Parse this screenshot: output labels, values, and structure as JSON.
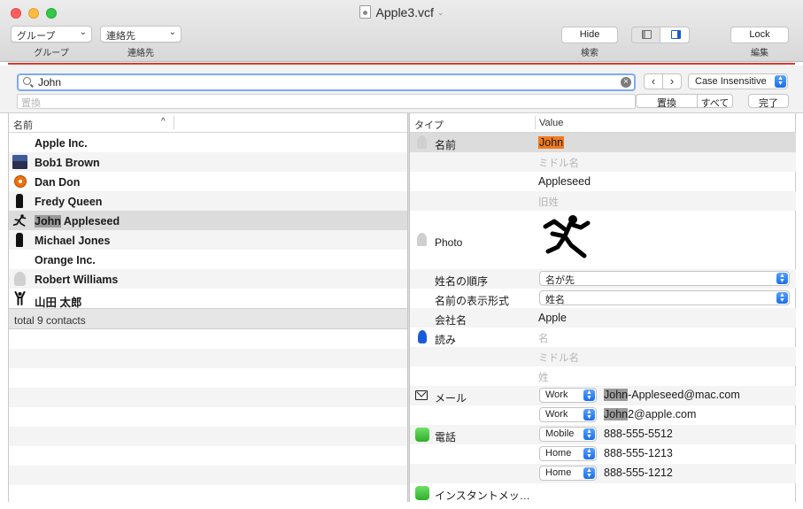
{
  "window": {
    "title": "Apple3.vcf"
  },
  "toolbar": {
    "group_popup": "グループ",
    "group_caption": "グループ",
    "contact_popup": "連絡先",
    "contact_caption": "連絡先",
    "hide_button": "Hide",
    "search_caption": "検索",
    "lock_button": "Lock",
    "edit_caption": "編集"
  },
  "find": {
    "query": "John",
    "replace_placeholder": "置換",
    "case_option": "Case Insensitive",
    "replace_button": "置換",
    "all_button": "すべて",
    "done_button": "完了",
    "prev_glyph": "‹",
    "next_glyph": "›"
  },
  "contact_list": {
    "column_header": "名前",
    "status": "total 9 contacts",
    "contacts": [
      {
        "name": "Apple Inc.",
        "avatar": "none"
      },
      {
        "name": "Bob1 Brown",
        "avatar": "mountain-photo"
      },
      {
        "name": "Dan Don",
        "avatar": "flower-photo"
      },
      {
        "name": "Fredy Queen",
        "avatar": "silhouette"
      },
      {
        "name_highlight": "John",
        "name_rest": " Appleseed",
        "avatar": "jumping-silhouette",
        "selected": true
      },
      {
        "name": "Michael Jones",
        "avatar": "silhouette"
      },
      {
        "name": "Orange Inc.",
        "avatar": "none"
      },
      {
        "name": "Robert Williams",
        "avatar": "generic-person"
      },
      {
        "name": "山田 太郎",
        "avatar": "silhouette-arms-up"
      }
    ]
  },
  "detail": {
    "type_header": "タイプ",
    "value_header": "Value",
    "name_label": "名前",
    "first_name": "John",
    "middle_placeholder": "ミドル名",
    "last_name": "Appleseed",
    "maiden_placeholder": "旧姓",
    "photo_label": "Photo",
    "name_order_label": "姓名の順序",
    "name_order_value": "名が先",
    "display_label": "名前の表示形式",
    "display_value": "姓名",
    "company_label": "会社名",
    "company_value": "Apple",
    "reading_label": "読み",
    "reading_first_placeholder": "名",
    "reading_middle_placeholder": "ミドル名",
    "reading_last_placeholder": "姓",
    "email_label": "メール",
    "emails": [
      {
        "type": "Work",
        "highlight": "John",
        "rest": "-Appleseed@mac.com"
      },
      {
        "type": "Work",
        "highlight": "John",
        "rest": "2@apple.com"
      }
    ],
    "phone_label": "電話",
    "phones": [
      {
        "type": "Mobile",
        "number": "888-555-5512"
      },
      {
        "type": "Home",
        "number": "888-555-1213"
      },
      {
        "type": "Home",
        "number": "888-555-1212"
      }
    ],
    "im_label": "インスタントメッ…"
  },
  "colors": {
    "accent_blue": "#1a6ee8",
    "highlight_orange": "#f07a1e",
    "highlight_gray": "#9a9a9a",
    "red_separator": "#e0342a"
  }
}
